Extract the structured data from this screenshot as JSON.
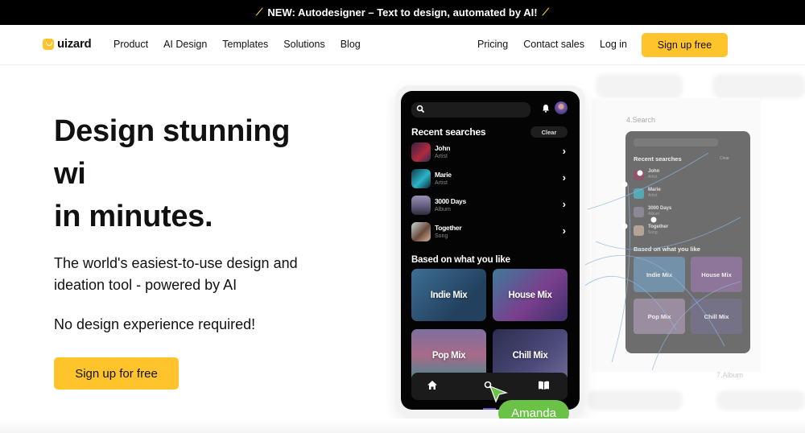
{
  "announcement": {
    "icon": "magic-wand-icon",
    "text": "NEW: Autodesigner – Text to design, automated by AI!"
  },
  "nav": {
    "logo_text": "uizard",
    "links": [
      "Product",
      "AI Design",
      "Templates",
      "Solutions",
      "Blog"
    ],
    "right_links": [
      "Pricing",
      "Contact sales",
      "Log in"
    ],
    "cta": "Sign up free"
  },
  "hero": {
    "title_line1": "Design stunning",
    "title_line2": "wi",
    "title_line3": "in minutes.",
    "subtitle": "The world's easiest-to-use design and ideation tool - powered by AI",
    "note": "No design experience required!",
    "cta": "Sign up for free"
  },
  "phone": {
    "recent_title": "Recent searches",
    "clear_label": "Clear",
    "recent": [
      {
        "name": "John",
        "kind": "Artist",
        "color": "#6b2d4a"
      },
      {
        "name": "Marie",
        "kind": "Artist",
        "color": "#1d8aa0"
      },
      {
        "name": "3000 Days",
        "kind": "Album",
        "color": "#6c6284"
      },
      {
        "name": "Together",
        "kind": "Song",
        "color": "#b59a86"
      }
    ],
    "based_title": "Based on what you like",
    "mixes": [
      {
        "label": "Indie Mix",
        "color": "#2f5f86"
      },
      {
        "label": "House Mix",
        "color": "#6a3f86"
      },
      {
        "label": "Pop Mix",
        "color": "#8c6a9a"
      },
      {
        "label": "Chill Mix",
        "color": "#3f3a66"
      }
    ],
    "tabs": [
      "home-icon",
      "search-icon",
      "book-icon"
    ],
    "cursor_label": "Amanda",
    "cursor_color": "#6ac246"
  },
  "canvas": {
    "frame_label_search": "4.Search",
    "frame_label_album": "7.Album",
    "mini_recent_title": "Recent searches",
    "mini_based_title": "Based on what you like",
    "mini_clear": "Clear"
  },
  "colors": {
    "brand": "#ffc42b",
    "banner_bg": "#000000"
  }
}
